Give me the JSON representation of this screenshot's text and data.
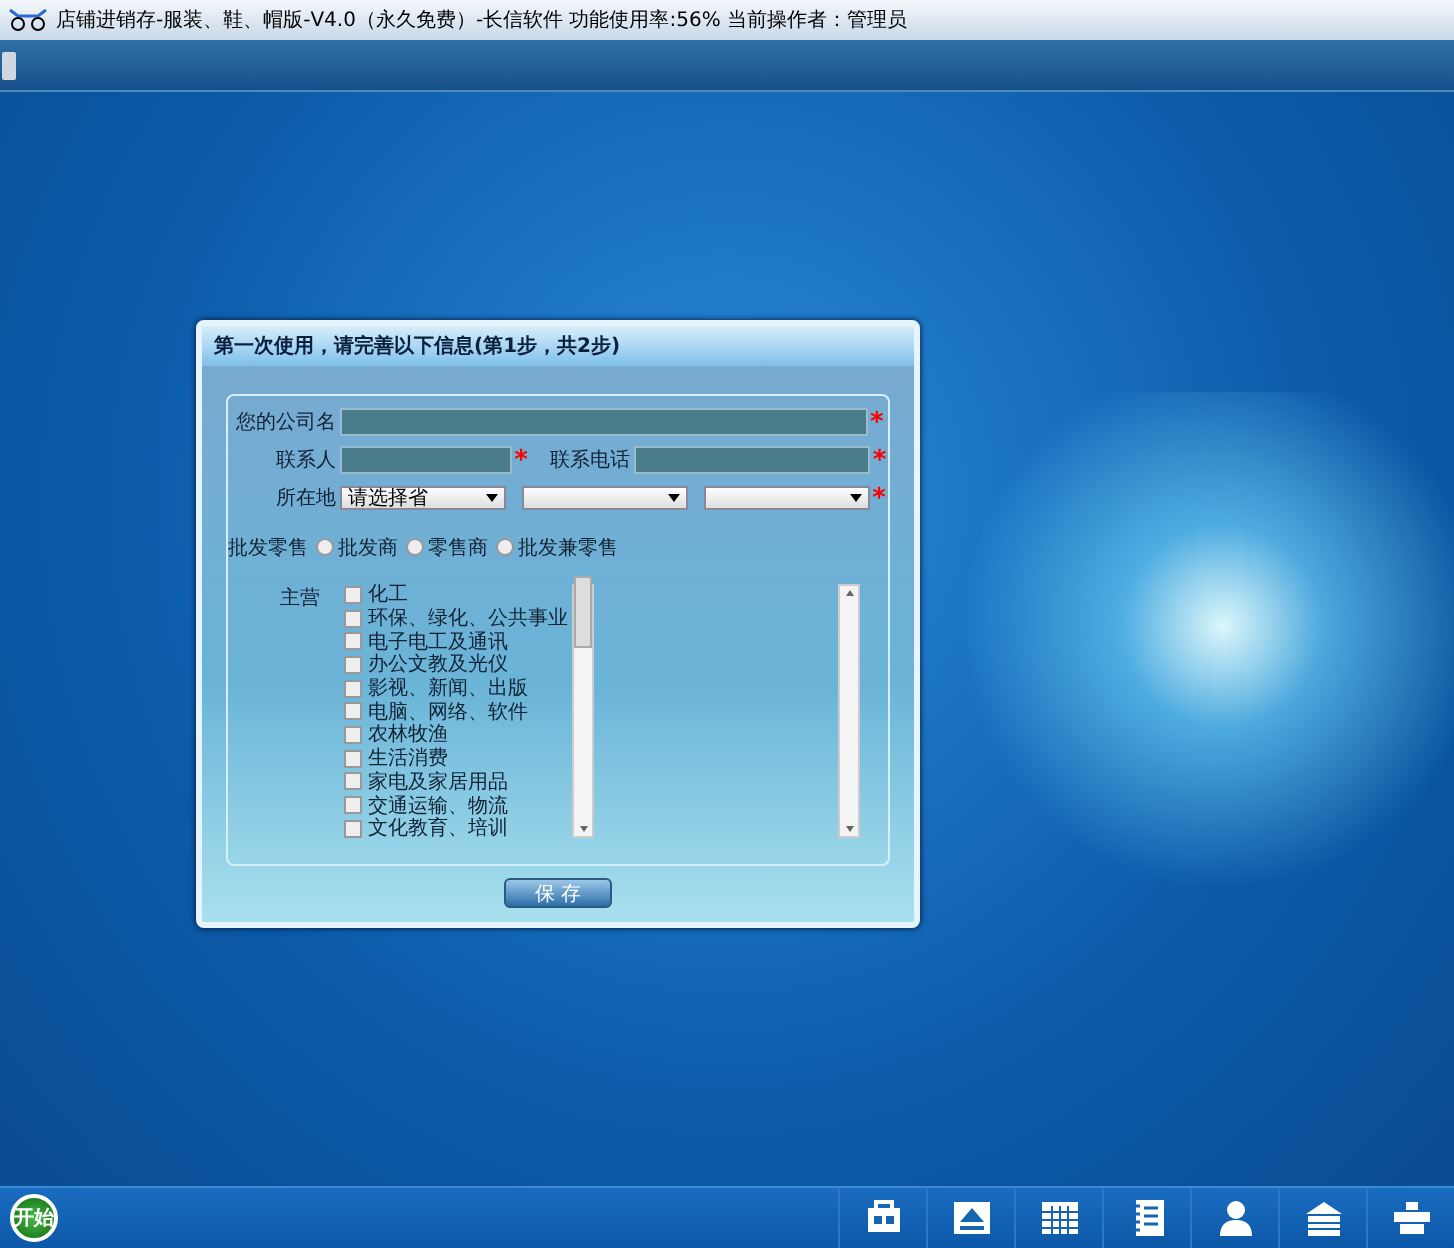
{
  "window": {
    "title": "店铺进销存-服装、鞋、帽版-V4.0（永久免费）-长信软件 功能使用率:56% 当前操作者：管理员"
  },
  "dialog": {
    "title": "第一次使用，请完善以下信息(第1步，共2步)",
    "company": {
      "label": "您的公司名",
      "required_mark": "*"
    },
    "contact": {
      "label": "联系人",
      "required_mark": "*"
    },
    "phone": {
      "label": "联系电话",
      "required_mark": "*"
    },
    "location": {
      "label": "所在地",
      "selects": [
        {
          "kind": "filled",
          "value": "请选择省"
        },
        {
          "kind": "empty"
        },
        {
          "kind": "empty"
        }
      ],
      "required_mark": "*"
    },
    "trade": {
      "label": "批发零售",
      "options": [
        {
          "label": "批发商",
          "selected": false
        },
        {
          "label": "零售商",
          "selected": false
        },
        {
          "label": "批发兼零售",
          "selected": false
        }
      ]
    },
    "business": {
      "label": "主营",
      "items": [
        {
          "label": "化工",
          "checked": false
        },
        {
          "label": "环保、绿化、公共事业",
          "checked": false
        },
        {
          "label": "电子电工及通讯",
          "checked": false
        },
        {
          "label": "办公文教及光仪",
          "checked": false
        },
        {
          "label": "影视、新闻、出版",
          "checked": false
        },
        {
          "label": "电脑、网络、软件",
          "checked": false
        },
        {
          "label": "农林牧渔",
          "checked": false
        },
        {
          "label": "生活消费",
          "checked": false
        },
        {
          "label": "家电及家居用品",
          "checked": false
        },
        {
          "label": "交通运输、物流",
          "checked": false
        },
        {
          "label": "文化教育、培训",
          "checked": false
        }
      ]
    },
    "save": "保 存"
  },
  "taskbar": {
    "start": "开始"
  }
}
